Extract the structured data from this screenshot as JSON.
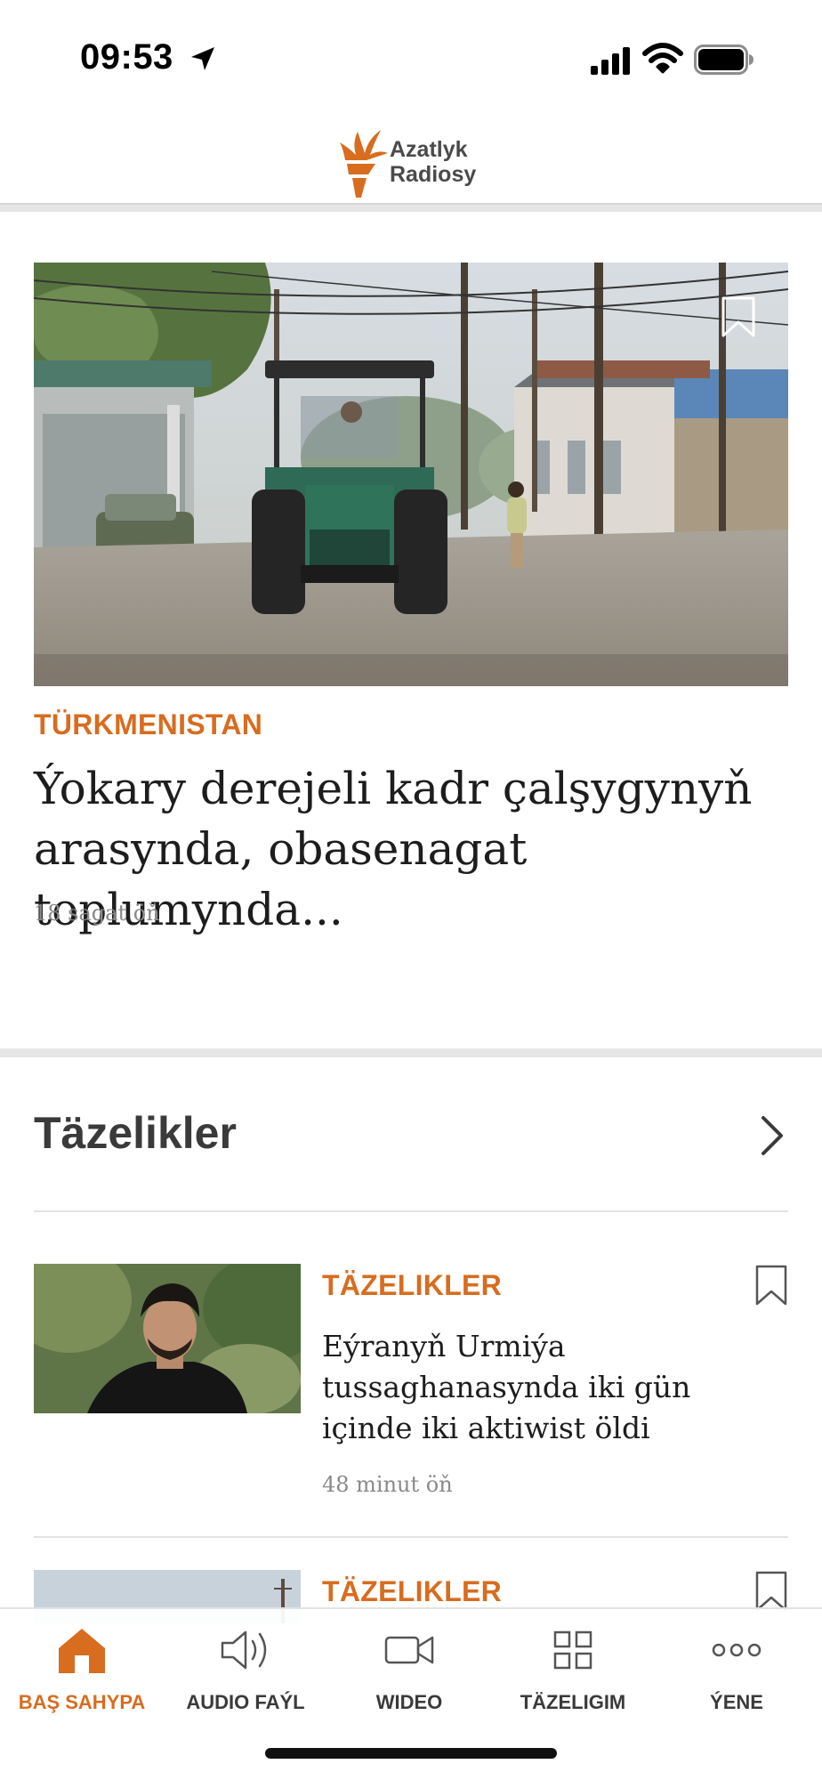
{
  "status_bar": {
    "time": "09:53"
  },
  "header": {
    "logo_line1": "Azatlyk",
    "logo_line2": "Radiosy",
    "brand_color": "#d86c1f"
  },
  "hero": {
    "category": "TÜRKMENISTAN",
    "title": "Ýokary derejeli kadr çalşygynyň arasynda, obasenagat toplumynda...",
    "time": "18 sagat öň"
  },
  "section": {
    "title": "Täzelikler"
  },
  "items": [
    {
      "category": "TÄZELIKLER",
      "title": "Eýranyň Urmiýa tussaghanasynda iki gün içinde iki aktiwist öldi",
      "time": "48 minut öň"
    },
    {
      "category": "TÄZELIKLER"
    }
  ],
  "tab_bar": {
    "tabs": [
      {
        "label": "BAŞ SAHYPA",
        "icon": "home-icon",
        "active": true
      },
      {
        "label": "AUDIO FAÝL",
        "icon": "speaker-icon",
        "active": false
      },
      {
        "label": "WIDEO",
        "icon": "video-icon",
        "active": false
      },
      {
        "label": "TÄZELIGIM",
        "icon": "grid-icon",
        "active": false
      },
      {
        "label": "ÝENE",
        "icon": "more-icon",
        "active": false
      }
    ]
  }
}
